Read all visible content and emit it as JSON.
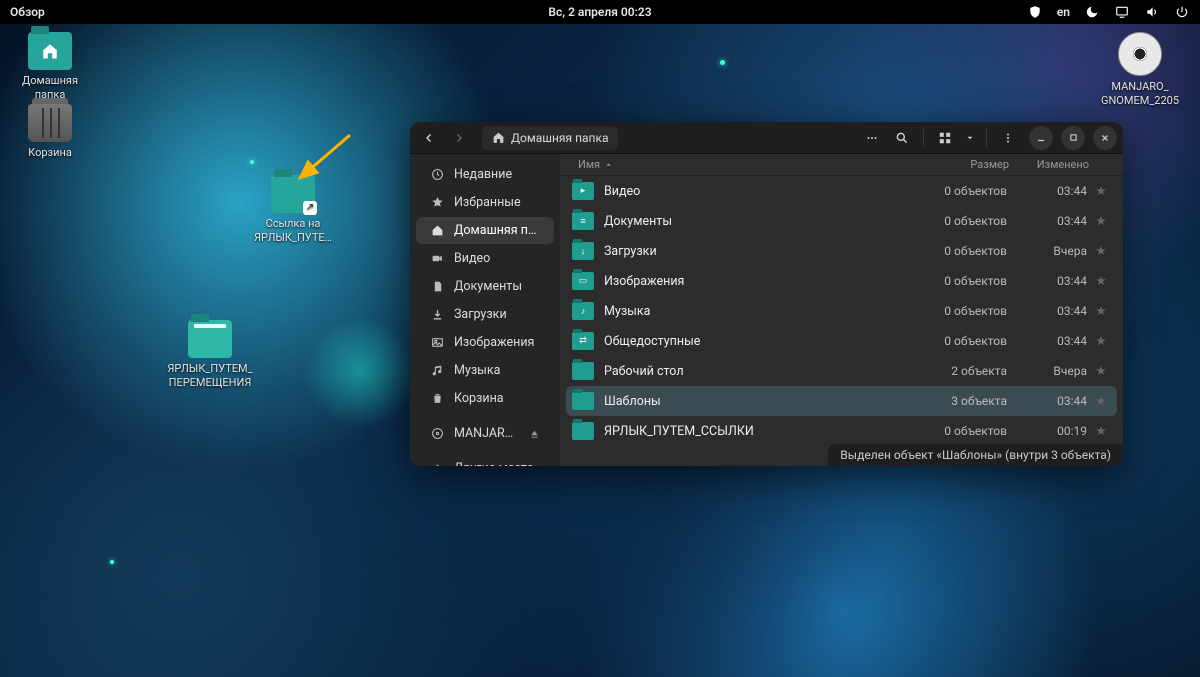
{
  "topbar": {
    "activities": "Обзор",
    "clock": "Вс, 2 апреля  00:23",
    "lang": "en"
  },
  "desktop": {
    "home": {
      "label1": "Домашняя",
      "label2": "папка"
    },
    "trash": {
      "label": "Корзина"
    },
    "link": {
      "label1": "Ссылка на",
      "label2": "ЯРЛЫК_ПУТЕ…"
    },
    "drag": {
      "label1": "ЯРЛЫК_ПУТЕМ_",
      "label2": "ПЕРЕМЕЩЕНИЯ"
    },
    "disc": {
      "label1": "MANJARO_",
      "label2": "GNOMEM_2205"
    }
  },
  "fm": {
    "path_label": "Домашняя папка",
    "sidebar": {
      "recent": "Недавние",
      "starred": "Избранные",
      "home": "Домашняя папка",
      "videos": "Видео",
      "documents": "Документы",
      "downloads": "Загрузки",
      "pictures": "Изображения",
      "music": "Музыка",
      "trash": "Корзина",
      "device": "MANJARO_GNOME…",
      "other": "Другие места"
    },
    "columns": {
      "name": "Имя",
      "size": "Размер",
      "modified": "Изменено"
    },
    "rows": [
      {
        "name": "Видео",
        "size": "0 объектов",
        "modified": "03:44",
        "selected": false,
        "mark": "▸"
      },
      {
        "name": "Документы",
        "size": "0 объектов",
        "modified": "03:44",
        "selected": false,
        "mark": "≡"
      },
      {
        "name": "Загрузки",
        "size": "0 объектов",
        "modified": "Вчера",
        "selected": false,
        "mark": "↓"
      },
      {
        "name": "Изображения",
        "size": "0 объектов",
        "modified": "03:44",
        "selected": false,
        "mark": "▭"
      },
      {
        "name": "Музыка",
        "size": "0 объектов",
        "modified": "03:44",
        "selected": false,
        "mark": "♪"
      },
      {
        "name": "Общедоступные",
        "size": "0 объектов",
        "modified": "03:44",
        "selected": false,
        "mark": "⇄"
      },
      {
        "name": "Рабочий стол",
        "size": "2 объекта",
        "modified": "Вчера",
        "selected": false,
        "mark": ""
      },
      {
        "name": "Шаблоны",
        "size": "3 объекта",
        "modified": "03:44",
        "selected": true,
        "mark": ""
      },
      {
        "name": "ЯРЛЫК_ПУТЕМ_ССЫЛКИ",
        "size": "0 объектов",
        "modified": "00:19",
        "selected": false,
        "mark": ""
      }
    ],
    "status": "Выделен объект «Шаблоны» (внутри 3 объекта)"
  }
}
